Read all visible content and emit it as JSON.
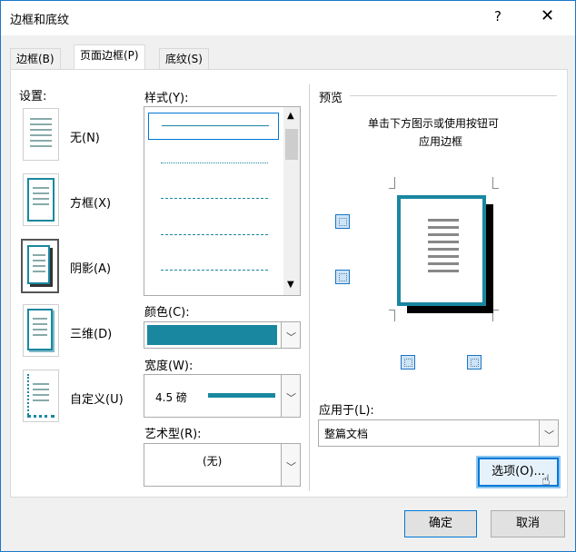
{
  "dialog": {
    "title": "边框和底纹",
    "help": "?",
    "close": "✕"
  },
  "tabs": [
    {
      "label": "边框(B)",
      "active": false
    },
    {
      "label": "页面边框(P)",
      "active": true
    },
    {
      "label": "底纹(S)",
      "active": false
    }
  ],
  "settings": {
    "heading": "设置:",
    "items": [
      {
        "label": "无(N)"
      },
      {
        "label": "方框(X)"
      },
      {
        "label": "阴影(A)",
        "selected": true
      },
      {
        "label": "三维(D)"
      },
      {
        "label": "自定义(U)"
      }
    ]
  },
  "style": {
    "label": "样式(Y):",
    "items": [
      "solid",
      "dotted",
      "dashed",
      "long-dash",
      "dash-dot"
    ]
  },
  "color": {
    "label": "颜色(C):",
    "value": "#1a87a0"
  },
  "width": {
    "label": "宽度(W):",
    "value": "4.5 磅"
  },
  "art": {
    "label": "艺术型(R):",
    "value": "(无)"
  },
  "preview": {
    "heading": "预览",
    "hint_line1": "单击下方图示或使用按钮可",
    "hint_line2": "应用边框"
  },
  "apply_to": {
    "label": "应用于(L):",
    "value": "整篇文档"
  },
  "buttons": {
    "options": "选项(O)...",
    "ok": "确定",
    "cancel": "取消"
  },
  "colors": {
    "accent": "#1a87a0",
    "focus": "#0078d7"
  }
}
